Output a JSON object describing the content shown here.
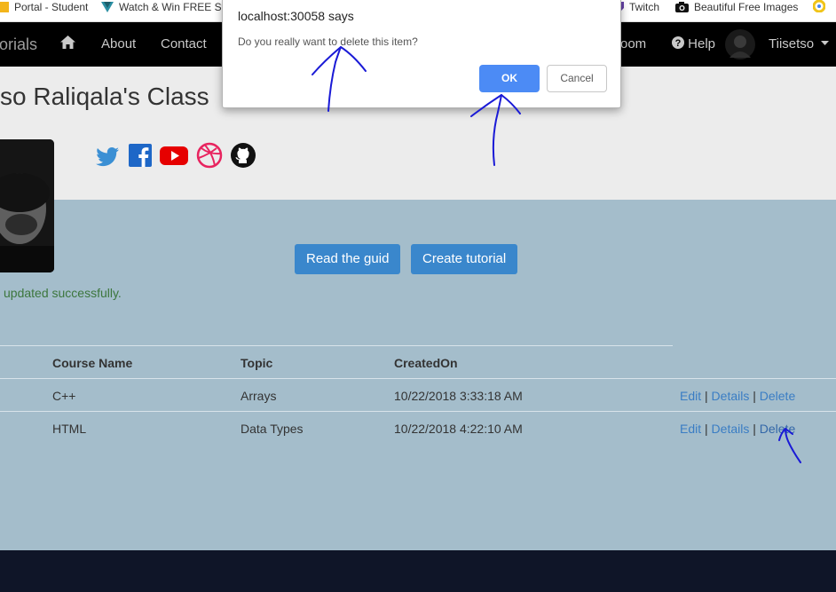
{
  "bookmarks": [
    {
      "label": "Portal - Student",
      "icon": "bookmark-folder-icon"
    },
    {
      "label": "Watch & Win FREE St",
      "icon": "vuetify-icon"
    },
    {
      "label": "Twitch",
      "icon": "twitch-icon"
    },
    {
      "label": "Beautiful Free Images",
      "icon": "camera-icon"
    }
  ],
  "navbar": {
    "brand": "orials",
    "about": "About",
    "contact": "Contact",
    "classroom": "oom",
    "help": "Help",
    "user": "Tiisetso",
    "home_icon": "home-icon",
    "help_icon": "question-circle-icon",
    "caret_icon": "caret-down-icon"
  },
  "header": {
    "title": "so Raliqala's Class",
    "socials": [
      "twitter-icon",
      "facebook-icon",
      "youtube-icon",
      "dribbble-icon",
      "github-icon"
    ]
  },
  "actions": {
    "read_guide": "Read the guid",
    "create_tutorial": "Create tutorial"
  },
  "status": {
    "message": "updated successfully."
  },
  "table": {
    "headers": [
      "Course Name",
      "Topic",
      "CreatedOn"
    ],
    "rows": [
      {
        "course": "C++",
        "topic": "Arrays",
        "created": "10/22/2018 3:33:18 AM"
      },
      {
        "course": "HTML",
        "topic": "Data Types",
        "created": "10/22/2018 4:22:10 AM"
      }
    ],
    "links": {
      "edit": "Edit",
      "details": "Details",
      "delete": "Delete",
      "separator": "|"
    }
  },
  "dialog": {
    "title": "localhost:30058 says",
    "message": "Do you really want to delete this item?",
    "ok": "OK",
    "cancel": "Cancel"
  },
  "colors": {
    "navbar": "#000000",
    "content_bg": "#a4bdcb",
    "primary_button": "#3a87cc",
    "link": "#3a7dc4",
    "success_text": "#3c763d",
    "dialog_ok": "#4c8bf5",
    "footer": "#0f1528",
    "annotation_ink": "#1a1ad6"
  }
}
